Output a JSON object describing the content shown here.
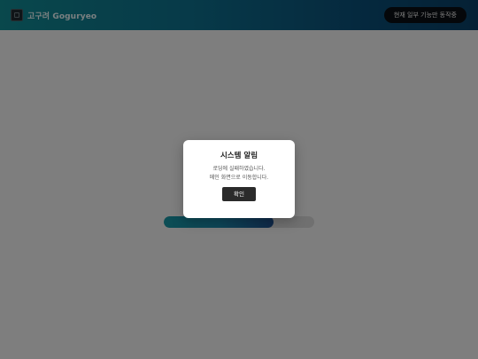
{
  "header": {
    "brand": "고구려 Goguryeo",
    "status_badge": "현재 일부 기능만 동작중"
  },
  "loading": {
    "progress": 0.73
  },
  "dialog": {
    "title": "시스템 알림",
    "message_line1": "로딩에 실패하였습니다.",
    "message_line2": "메인 화면으로 이동합니다.",
    "confirm_label": "확인"
  },
  "colors": {
    "header_gradient_start": "#128a93",
    "header_gradient_end": "#0a3f66",
    "progress_fill": "#1a86a8",
    "confirm_button": "#2b2b2b"
  }
}
